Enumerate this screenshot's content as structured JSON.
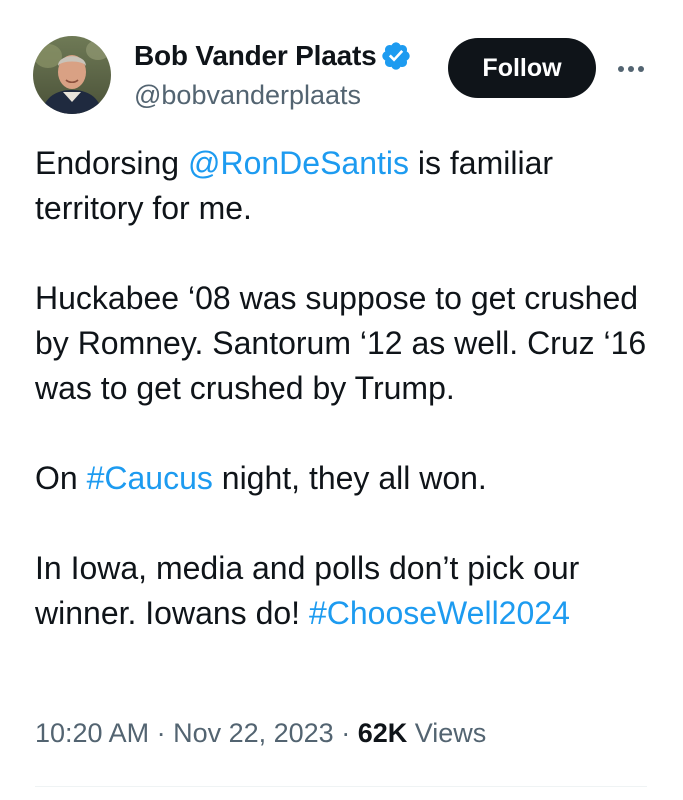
{
  "author": {
    "display_name": "Bob Vander Plaats",
    "handle": "@bobvanderplaats",
    "verified": true
  },
  "actions": {
    "follow_label": "Follow",
    "more_icon": "more-horizontal-icon"
  },
  "tweet": {
    "p1_before": "Endorsing ",
    "p1_mention": "@RonDeSantis",
    "p1_after": " is familiar territory for me.",
    "p2": "Huckabee ‘08 was suppose to get crushed by Romney. Santorum ‘12 as well. Cruz ‘16 was to get crushed by Trump.",
    "p3_before": "On ",
    "p3_hashtag": "#Caucus",
    "p3_after": " night, they all won.",
    "p4_before": "In Iowa, media and polls don’t pick our winner. Iowans do! ",
    "p4_hashtag": "#ChooseWell2024"
  },
  "meta": {
    "time": "10:20 AM",
    "separator": " · ",
    "date": "Nov 22, 2023",
    "views_count": "62K",
    "views_label": " Views"
  },
  "colors": {
    "link": "#1d9bf0",
    "text": "#0f1419",
    "secondary": "#536471",
    "button_bg": "#0f1419"
  }
}
